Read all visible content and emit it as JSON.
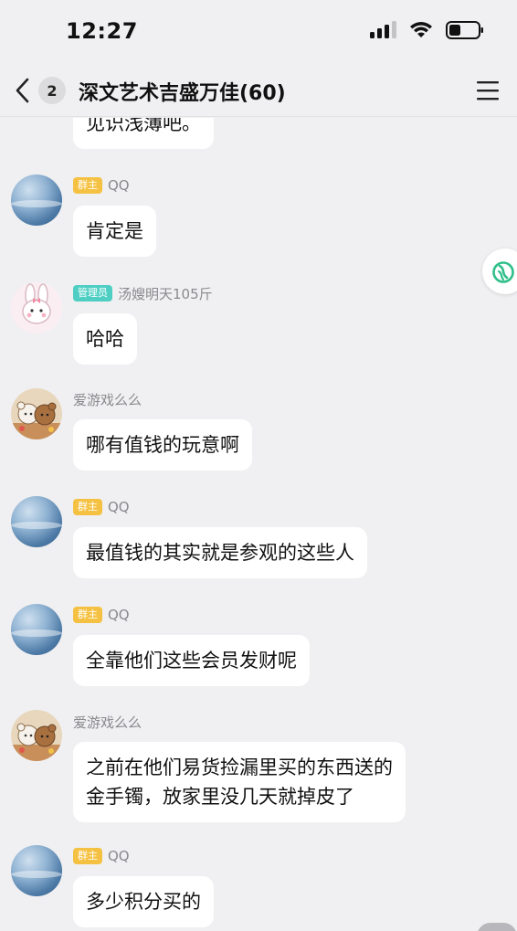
{
  "status_bar": {
    "time": "12:27"
  },
  "nav": {
    "unread_count": "2",
    "title": "深文艺术吉盛万佳(60)"
  },
  "tags": {
    "owner": "群主",
    "admin": "管理员"
  },
  "messages": [
    {
      "text": "见识浅薄吧。"
    },
    {
      "sender": "QQ",
      "text": "肯定是"
    },
    {
      "sender": "汤嫂明天105斤",
      "text": "哈哈"
    },
    {
      "sender": "爱游戏么么",
      "text": "哪有值钱的玩意啊"
    },
    {
      "sender": "QQ",
      "text": "最值钱的其实就是参观的这些人"
    },
    {
      "sender": "QQ",
      "text": "全靠他们这些会员发财呢"
    },
    {
      "sender": "爱游戏么么",
      "text_line1": "之前在他们易货捡漏里买的东西送的",
      "text_line2": "金手镯，放家里没几天就掉皮了"
    },
    {
      "sender": "QQ",
      "text": "多少积分买的"
    }
  ],
  "icons": {
    "back": "chevron-left-icon",
    "menu": "hamburger-menu-icon",
    "signal": "cellular-signal-icon",
    "wifi": "wifi-icon",
    "battery": "battery-icon",
    "floating": "leaf-swirl-icon"
  },
  "colors": {
    "background": "#f0f0f2",
    "bubble": "#ffffff",
    "owner_tag": "#f5c142",
    "admin_tag": "#4fcfc3",
    "floating_icon": "#2fbf8a"
  }
}
